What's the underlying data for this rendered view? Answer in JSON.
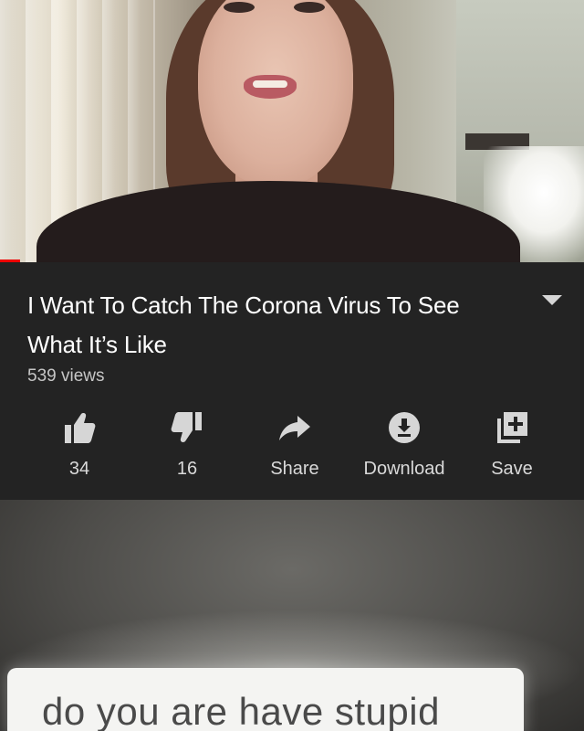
{
  "video": {
    "title": "I Want To Catch The Corona Virus To See What It’s Like",
    "views": "539 views"
  },
  "actions": [
    {
      "label": "34",
      "icon": "thumbs-up-icon"
    },
    {
      "label": "16",
      "icon": "thumbs-down-icon"
    },
    {
      "label": "Share",
      "icon": "share-arrow-icon"
    },
    {
      "label": "Download",
      "icon": "download-icon"
    },
    {
      "label": "Save",
      "icon": "add-to-playlist-icon"
    }
  ],
  "comment": {
    "text": "do you are have stupid"
  },
  "colors": {
    "panel_bg": "#232323",
    "progress_red": "#ee0000",
    "icon_grey": "#d6d6d6"
  }
}
